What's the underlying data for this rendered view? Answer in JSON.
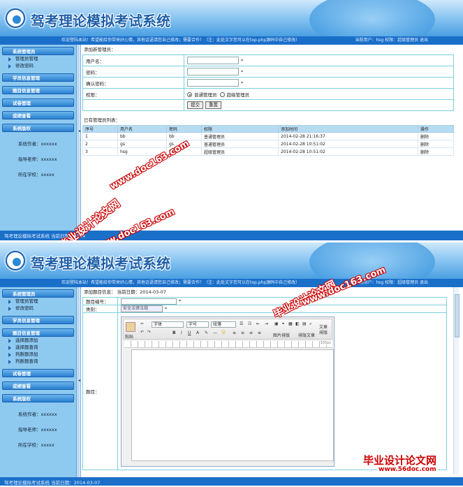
{
  "app": {
    "title": "驾考理论模拟考试系统",
    "notice": "欢迎登陆本站！希望能给你带来好心情，其他话语请您自己修改；需要合作！（注：此处文字您可以在top.php源码中自己修改）",
    "user_bar": "当前用户：hsg 权限：超级管理员 退出",
    "footer1": "驾考理论模拟考试系统 当前日期：2014",
    "footer2": "驾考理论模拟考试系统 当前日期：2014-03-07"
  },
  "sidebar": {
    "sections": [
      "系统管理员",
      "学员信息管理",
      "题目信息管理",
      "试卷管理",
      "成绩查看",
      "系统版权"
    ],
    "admin_items": [
      "管理员管理",
      "修改密码"
    ],
    "question_items": [
      "选择题添加",
      "选择题查询",
      "判断题添加",
      "判断题查询"
    ],
    "author": "系统作者：xxxxxx",
    "teacher": "指导老师：xxxxxx",
    "school": "所在学校：xxxxx"
  },
  "screen1": {
    "add_heading": "添加新管理员：",
    "username_label": "用户名：",
    "password_label": "密码：",
    "confirm_label": "确认密码：",
    "role_label": "权限：",
    "required": "*",
    "role_normal": "普通管理员",
    "role_super": "超级管理员",
    "submit": "提交",
    "reset": "重置",
    "list_heading": "已有管理员列表：",
    "columns": [
      "序号",
      "用户名",
      "密码",
      "权限",
      "添加时间",
      "操作"
    ],
    "rows": [
      [
        "1",
        "bb",
        "bb",
        "普通管理员",
        "2014-02-28 21:16:37",
        "删除"
      ],
      [
        "2",
        "gs",
        "gs",
        "普通管理员",
        "2014-02-28 10:51:02",
        "删除"
      ],
      [
        "3",
        "hsg",
        "hsg",
        "超级管理员",
        "2014-02-28 10:51:02",
        "删除"
      ]
    ]
  },
  "screen2": {
    "heading": "添加题目信息：",
    "date_prefix": "当前日期：",
    "date": "2014-03-07",
    "qno_label": "题目编号：",
    "type_label": "类别：",
    "type_value": "安全法律法规",
    "question_label": "题目：",
    "toolbar": {
      "paste": "粘贴",
      "font": "字体",
      "size": "字号",
      "para": "段落",
      "img_layout": "图片排版",
      "layout": "排版文章",
      "doc_layout": "文章排版",
      "ruler": "300px"
    }
  },
  "watermarks": {
    "site_cn": "毕业设计论文网",
    "site_url": "www.doc163.com",
    "site_url2": "www.56doc.com"
  }
}
